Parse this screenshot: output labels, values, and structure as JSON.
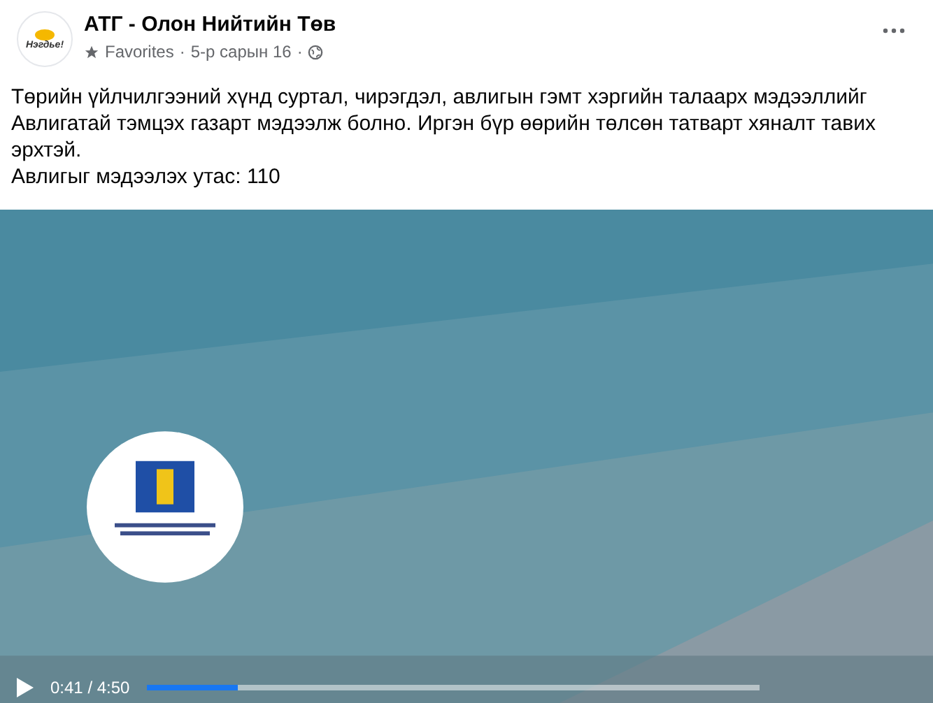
{
  "post": {
    "author": "АТГ - Олон Нийтийн Төв",
    "avatar_text": "Нэгдье!",
    "audience": "Favorites",
    "separator_1": "·",
    "date": "5-р сарын 16",
    "separator_2": "·",
    "body": [
      "Төрийн үйлчилгээний хүнд суртал, чирэгдэл, авлигын гэмт хэргийн талаарх мэдээллийг Авлигатай тэмцэх газарт мэдээлж болно. Иргэн бүр өөрийн төлсөн татварт хяналт тавих эрхтэй.",
      "Авлигыг мэдээлэх утас: 110"
    ]
  },
  "video": {
    "kind": "picture",
    "time": "0:41 / 4:50",
    "progress": {
      "level": 0.15
    }
  }
}
